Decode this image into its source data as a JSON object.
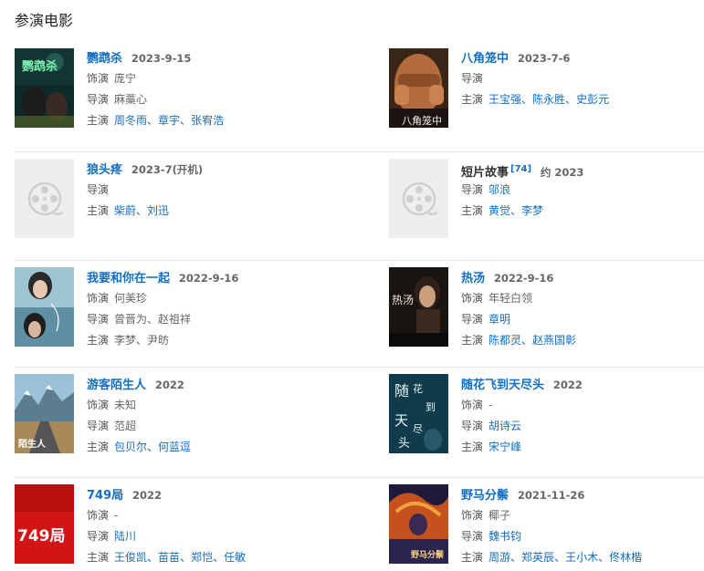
{
  "section_title": "参演电影",
  "labels": {
    "role": "饰演",
    "director": "导演",
    "cast": "主演"
  },
  "films": [
    {
      "title": "鹦鹉杀",
      "date": "2023-9-15",
      "poster_icon": "movie-poster",
      "role": "庞宁",
      "director": null,
      "director_plain": "麻藁心",
      "cast": [
        "周冬雨",
        "章宇",
        "张宥浩"
      ],
      "has_role": true
    },
    {
      "title": "八角笼中",
      "date": "2023-7-6",
      "poster_icon": "movie-poster",
      "role": "",
      "director": null,
      "cast": [
        "王宝强",
        "陈永胜",
        "史彭元"
      ],
      "has_role": false
    },
    {
      "title": "狼头疼",
      "date": "2023-7(开机)",
      "poster_icon": "film-reel-placeholder-icon",
      "director": [],
      "cast": [
        "柴蔚",
        "刘迅"
      ]
    },
    {
      "title": "短片故事",
      "ref": "[74]",
      "date": "约 2023",
      "poster_icon": "film-reel-placeholder-icon",
      "director": [
        "邬浪"
      ],
      "cast": [
        "黄觉",
        "李梦"
      ]
    },
    {
      "title": "我要和你在一起",
      "date": "2022-9-16",
      "poster_icon": "movie-poster",
      "role": "何美珍",
      "director": [
        "曾晋为",
        "赵祖祥"
      ],
      "cast": [
        "李梦",
        "尹昉"
      ]
    },
    {
      "title": "热汤",
      "date": "2022-9-16",
      "poster_icon": "movie-poster",
      "role": "年轻白领",
      "director": [
        "章明"
      ],
      "cast": [
        "陈都灵",
        "赵燕国彰"
      ]
    },
    {
      "title": "游客陌生人",
      "date": "2022",
      "poster_icon": "movie-poster",
      "role": "未知",
      "director_plain": "范超",
      "cast": [
        "包贝尔",
        "何蓝逗"
      ]
    },
    {
      "title": "随花飞到天尽头",
      "date": "2022",
      "poster_icon": "movie-poster",
      "role": "-",
      "director": [
        "胡诗云"
      ],
      "cast": [
        "宋宁峰"
      ]
    },
    {
      "title": "749局",
      "date": "2022",
      "poster_icon": "movie-poster",
      "role": "-",
      "director": [
        "陆川"
      ],
      "cast": [
        "王俊凯",
        "苗苗",
        "郑恺",
        "任敏"
      ]
    },
    {
      "title": "野马分鬃",
      "date": "2021-11-26",
      "poster_icon": "movie-poster",
      "role": "椰子",
      "director": [
        "魏书钧"
      ],
      "cast": [
        "周游",
        "郑英辰",
        "王小木",
        "佟林楷"
      ]
    }
  ],
  "poster_text": {
    "f9": "749局"
  },
  "colors": {
    "link": "#136ec2",
    "date": "#666666",
    "divider": "#e9e9e9",
    "placeholder_bg": "#eeeeee"
  }
}
